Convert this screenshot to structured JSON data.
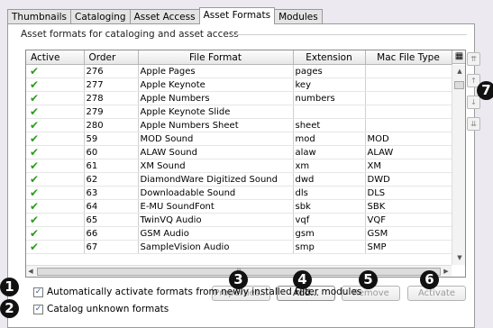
{
  "tabs": [
    "Thumbnails",
    "Cataloging",
    "Asset Access",
    "Asset Formats",
    "Modules"
  ],
  "active_tab": "Asset Formats",
  "group_title": "Asset formats for cataloging and asset access",
  "table": {
    "columns": [
      "Active",
      "Order",
      "File Format",
      "Extension",
      "Mac File Type"
    ],
    "rows": [
      {
        "active": true,
        "order": "276",
        "format": "Apple Pages",
        "ext": "pages",
        "mac": ""
      },
      {
        "active": true,
        "order": "277",
        "format": "Apple Keynote",
        "ext": "key",
        "mac": ""
      },
      {
        "active": true,
        "order": "278",
        "format": "Apple Numbers",
        "ext": "numbers",
        "mac": ""
      },
      {
        "active": true,
        "order": "279",
        "format": "Apple Keynote Slide",
        "ext": "",
        "mac": ""
      },
      {
        "active": true,
        "order": "280",
        "format": "Apple Numbers Sheet",
        "ext": "sheet",
        "mac": ""
      },
      {
        "active": true,
        "order": "59",
        "format": "MOD Sound",
        "ext": "mod",
        "mac": "MOD"
      },
      {
        "active": true,
        "order": "60",
        "format": "ALAW Sound",
        "ext": "alaw",
        "mac": "ALAW"
      },
      {
        "active": true,
        "order": "61",
        "format": "XM Sound",
        "ext": "xm",
        "mac": "XM"
      },
      {
        "active": true,
        "order": "62",
        "format": "DiamondWare Digitized Sound",
        "ext": "dwd",
        "mac": "DWD"
      },
      {
        "active": true,
        "order": "63",
        "format": "Downloadable Sound",
        "ext": "dls",
        "mac": "DLS"
      },
      {
        "active": true,
        "order": "64",
        "format": "E-MU SoundFont",
        "ext": "sbk",
        "mac": "SBK"
      },
      {
        "active": true,
        "order": "65",
        "format": "TwinVQ Audio",
        "ext": "vqf",
        "mac": "VQF"
      },
      {
        "active": true,
        "order": "66",
        "format": "GSM Audio",
        "ext": "gsm",
        "mac": "GSM"
      },
      {
        "active": true,
        "order": "67",
        "format": "SampleVision Audio",
        "ext": "smp",
        "mac": "SMP"
      }
    ]
  },
  "scroll_glyphs": {
    "up": "▲",
    "down": "▼",
    "left": "◀",
    "right": "▶",
    "grip": "III",
    "column_chooser": "▦"
  },
  "buttons": {
    "properties": "Properties...",
    "add": "Add...",
    "remove": "Remove",
    "activate": "Activate"
  },
  "side_buttons": [
    {
      "icon": "move-to-top-icon",
      "glyph": "⇈"
    },
    {
      "icon": "move-up-icon",
      "glyph": "↑"
    },
    {
      "icon": "move-down-icon",
      "glyph": "↓"
    },
    {
      "icon": "move-to-bottom-icon",
      "glyph": "⇊"
    }
  ],
  "checkboxes": [
    {
      "label": "Automatically activate formats from newly installed Filter modules",
      "checked": true
    },
    {
      "label": "Catalog unknown formats",
      "checked": true
    }
  ],
  "callouts": [
    "1",
    "2",
    "3",
    "4",
    "5",
    "6",
    "7"
  ],
  "colors": {
    "active_check": "#2e9a1e",
    "callout_bg": "#111111"
  }
}
